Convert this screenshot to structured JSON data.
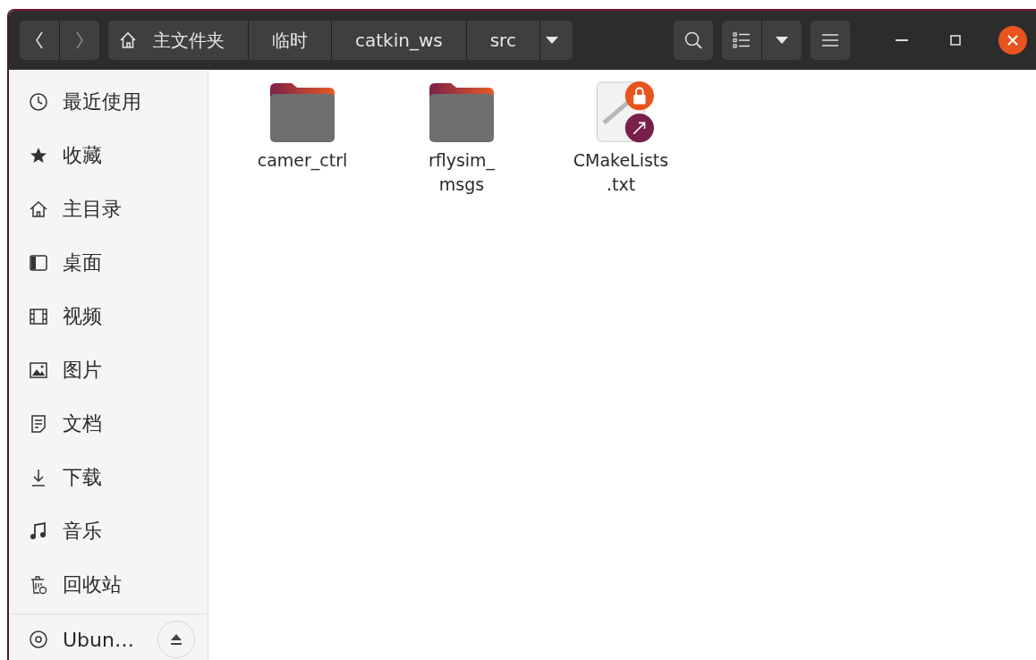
{
  "nav": {
    "back_disabled": false,
    "forward_disabled": true
  },
  "path": [
    {
      "label": "主文件夹",
      "home": true
    },
    {
      "label": "临时",
      "home": false
    },
    {
      "label": "catkin_ws",
      "home": false
    },
    {
      "label": "src",
      "home": false
    }
  ],
  "sidebar": {
    "items": [
      {
        "label": "最近使用",
        "kind": "recent"
      },
      {
        "label": "收藏",
        "kind": "star"
      },
      {
        "label": "主目录",
        "kind": "home"
      },
      {
        "label": "桌面",
        "kind": "desktop"
      },
      {
        "label": "视频",
        "kind": "video"
      },
      {
        "label": "图片",
        "kind": "picture"
      },
      {
        "label": "文档",
        "kind": "document"
      },
      {
        "label": "下载",
        "kind": "download"
      },
      {
        "label": "音乐",
        "kind": "music"
      },
      {
        "label": "回收站",
        "kind": "trash"
      }
    ],
    "devices": [
      {
        "label": "Ubun…"
      }
    ]
  },
  "files": [
    {
      "name": "camer_ctrl",
      "kind": "folder"
    },
    {
      "name": "rflysim_\nmsgs",
      "kind": "folder"
    },
    {
      "name": "CMakeLists\n.txt",
      "kind": "locked-link"
    }
  ]
}
